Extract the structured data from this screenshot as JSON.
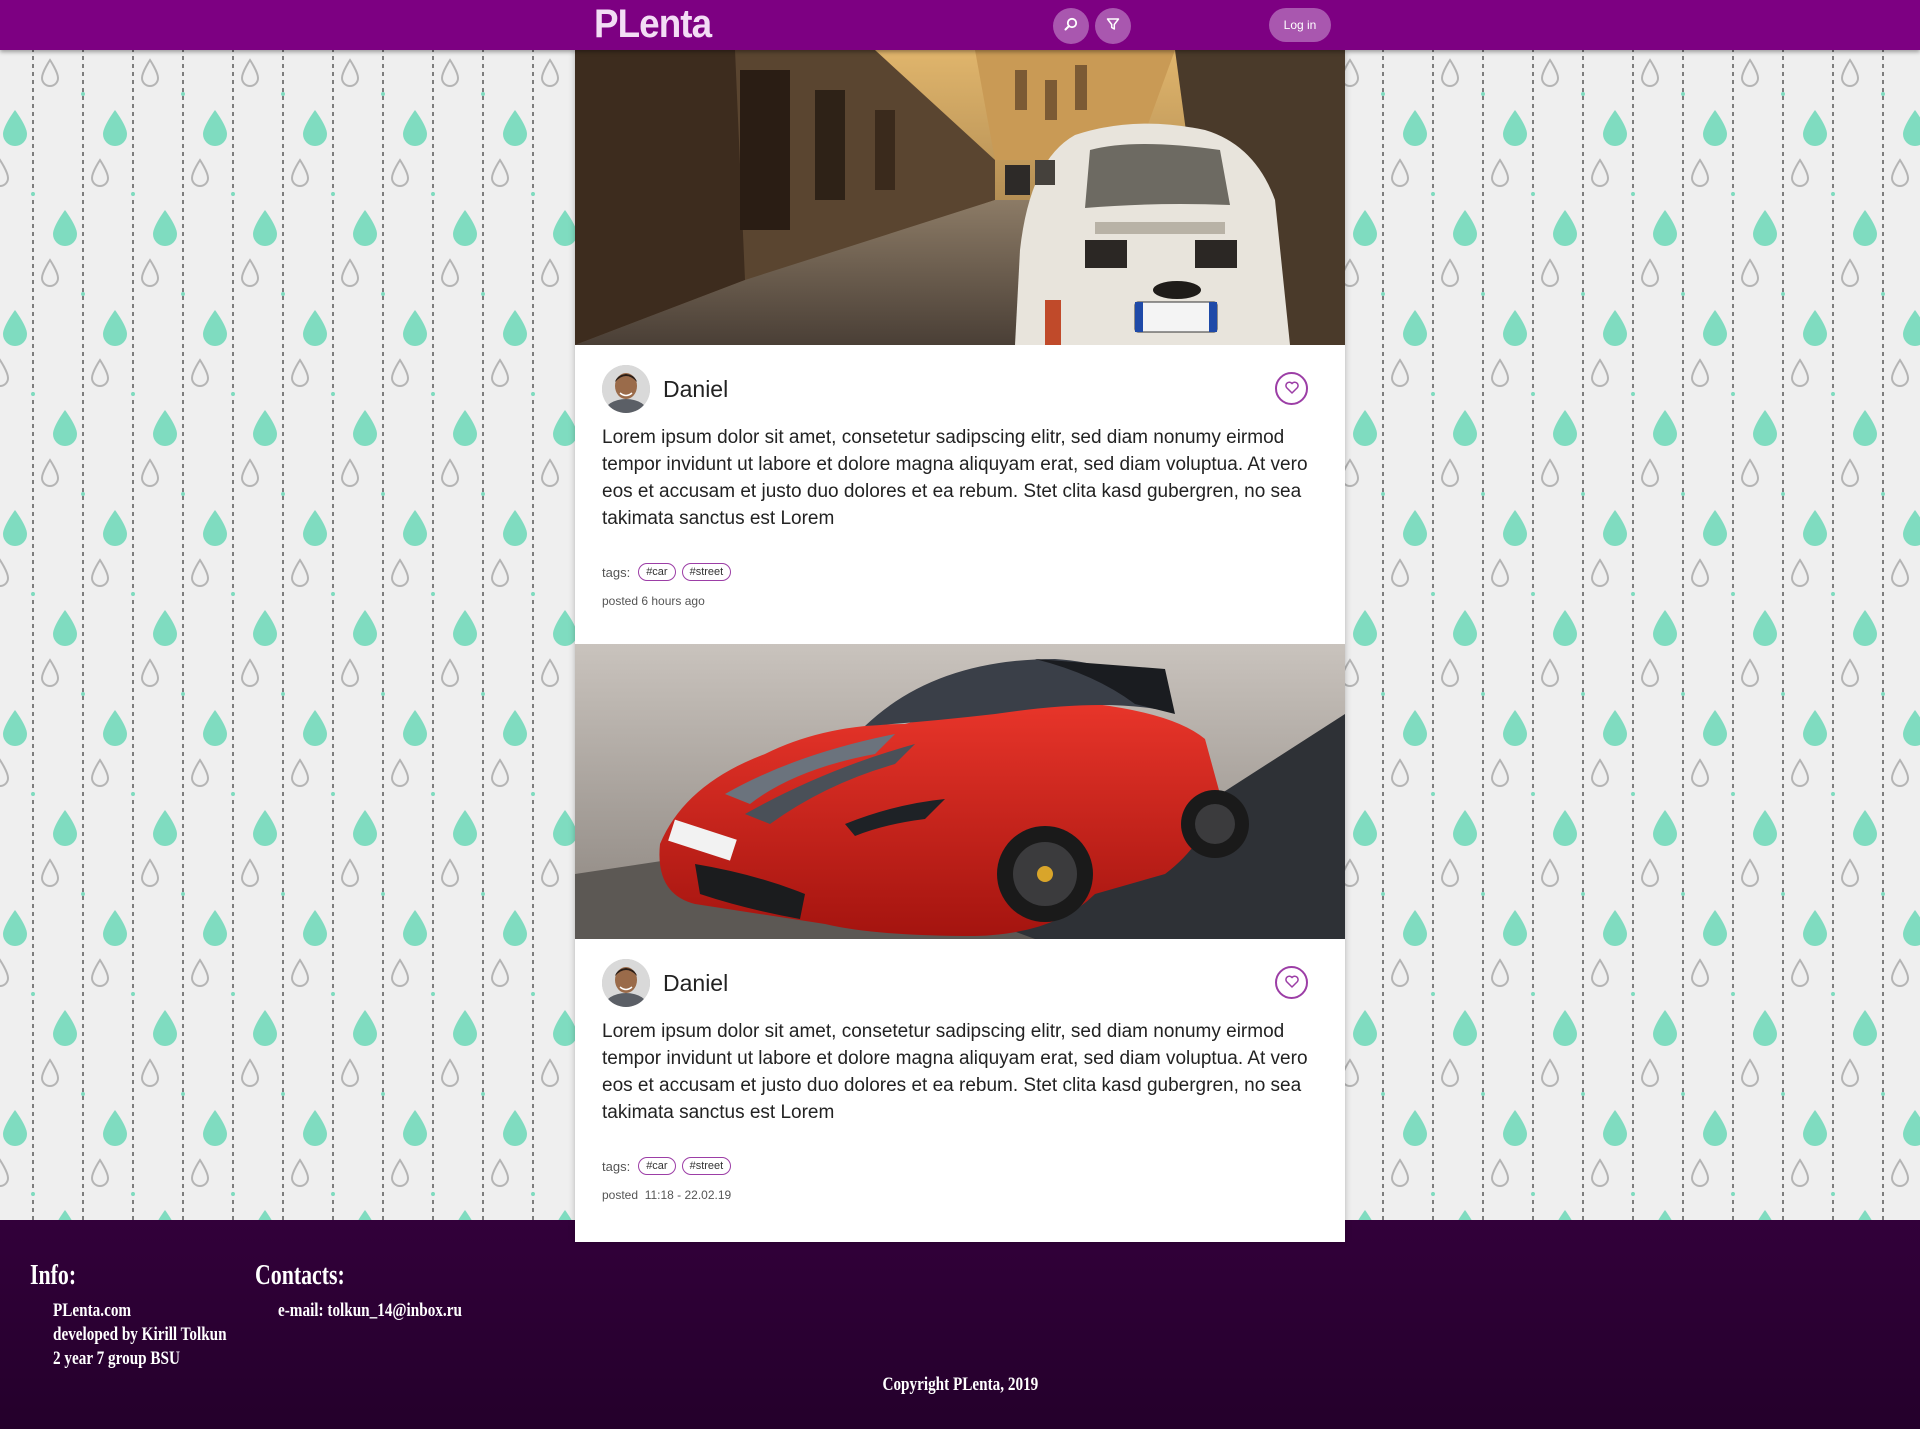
{
  "header": {
    "logo": "PLenta",
    "search_icon": "search-icon",
    "filter_icon": "filter-icon",
    "login_label": "Log in"
  },
  "colors": {
    "header_bg": "#7d0082",
    "accent": "#9c3ea6",
    "footer_bg": "#2c0033",
    "drop_mint": "#7fdcc0"
  },
  "posts": [
    {
      "image": "Vintage white car parked in a narrow cobblestone street",
      "author": "Daniel",
      "text": "Lorem ipsum dolor sit amet, consetetur sadipscing elitr, sed diam nonumy eirmod tempor invidunt ut labore et dolore magna aliquyam erat, sed diam voluptua. At vero eos et accusam et justo duo dolores et ea rebum. Stet clita kasd gubergren, no sea takimata sanctus est Lorem",
      "tags_label": "tags:",
      "tags": [
        "#car",
        "#street"
      ],
      "posted": "posted 6 hours ago",
      "like_icon": "heart-icon"
    },
    {
      "image": "Red convertible sports car on a desert road",
      "author": "Daniel",
      "text": "Lorem ipsum dolor sit amet, consetetur sadipscing elitr, sed diam nonumy eirmod tempor invidunt ut labore et dolore magna aliquyam erat, sed diam voluptua. At vero eos et accusam et justo duo dolores et ea rebum. Stet clita kasd gubergren, no sea takimata sanctus est Lorem",
      "tags_label": "tags:",
      "tags": [
        "#car",
        "#street"
      ],
      "posted": "posted  11:18 - 22.02.19",
      "like_icon": "heart-icon"
    }
  ],
  "footer": {
    "info_heading": "Info:",
    "info_lines": [
      "PLenta.com",
      "developed by Kirill Tolkun",
      "2 year 7 group BSU"
    ],
    "contacts_heading": "Contacts:",
    "contacts_lines": [
      "e-mail: tolkun_14@inbox.ru"
    ],
    "copyright": "Copyright PLenta, 2019"
  }
}
